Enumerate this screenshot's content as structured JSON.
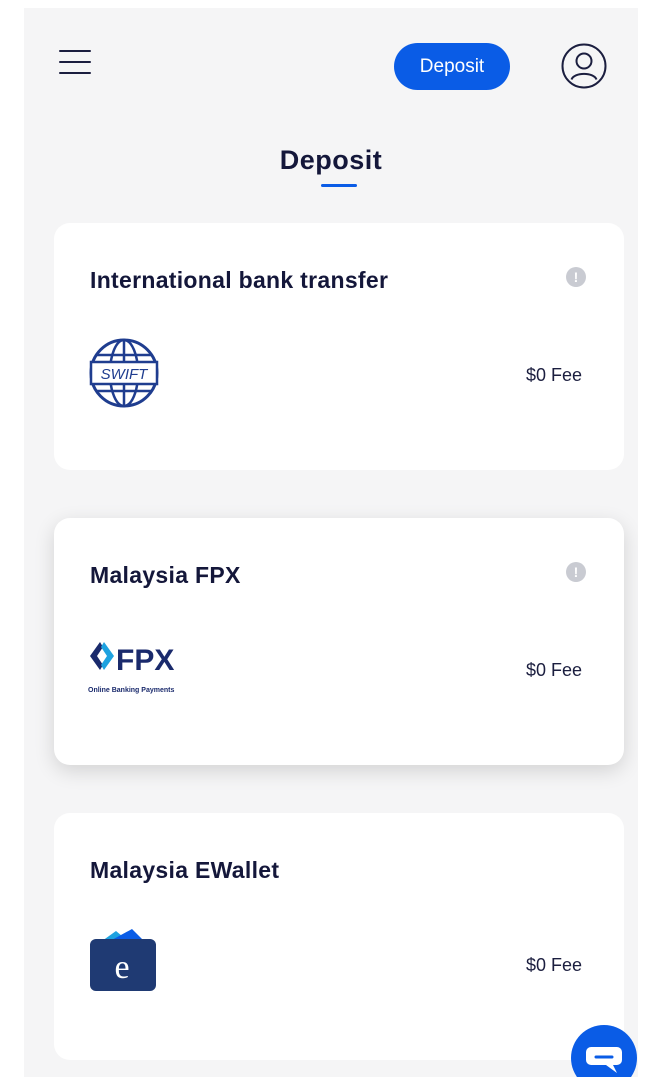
{
  "header": {
    "menu_icon": "hamburger-menu-icon",
    "deposit_button_label": "Deposit",
    "profile_icon": "user-profile-icon"
  },
  "page": {
    "title": "Deposit",
    "accent_color": "#0a5ce6"
  },
  "methods": [
    {
      "title": "International bank transfer",
      "fee": "$0 Fee",
      "logo": "swift-logo",
      "info_icon": "!"
    },
    {
      "title": "Malaysia FPX",
      "fee": "$0 Fee",
      "logo": "fpx-logo",
      "logo_text": "FPX",
      "logo_subtitle": "Online Banking Payments",
      "info_icon": "!",
      "selected": true
    },
    {
      "title": "Malaysia EWallet",
      "fee": "$0 Fee",
      "logo": "ewallet-logo",
      "logo_text": "e"
    }
  ],
  "chat": {
    "icon": "chat-bubble-icon"
  }
}
